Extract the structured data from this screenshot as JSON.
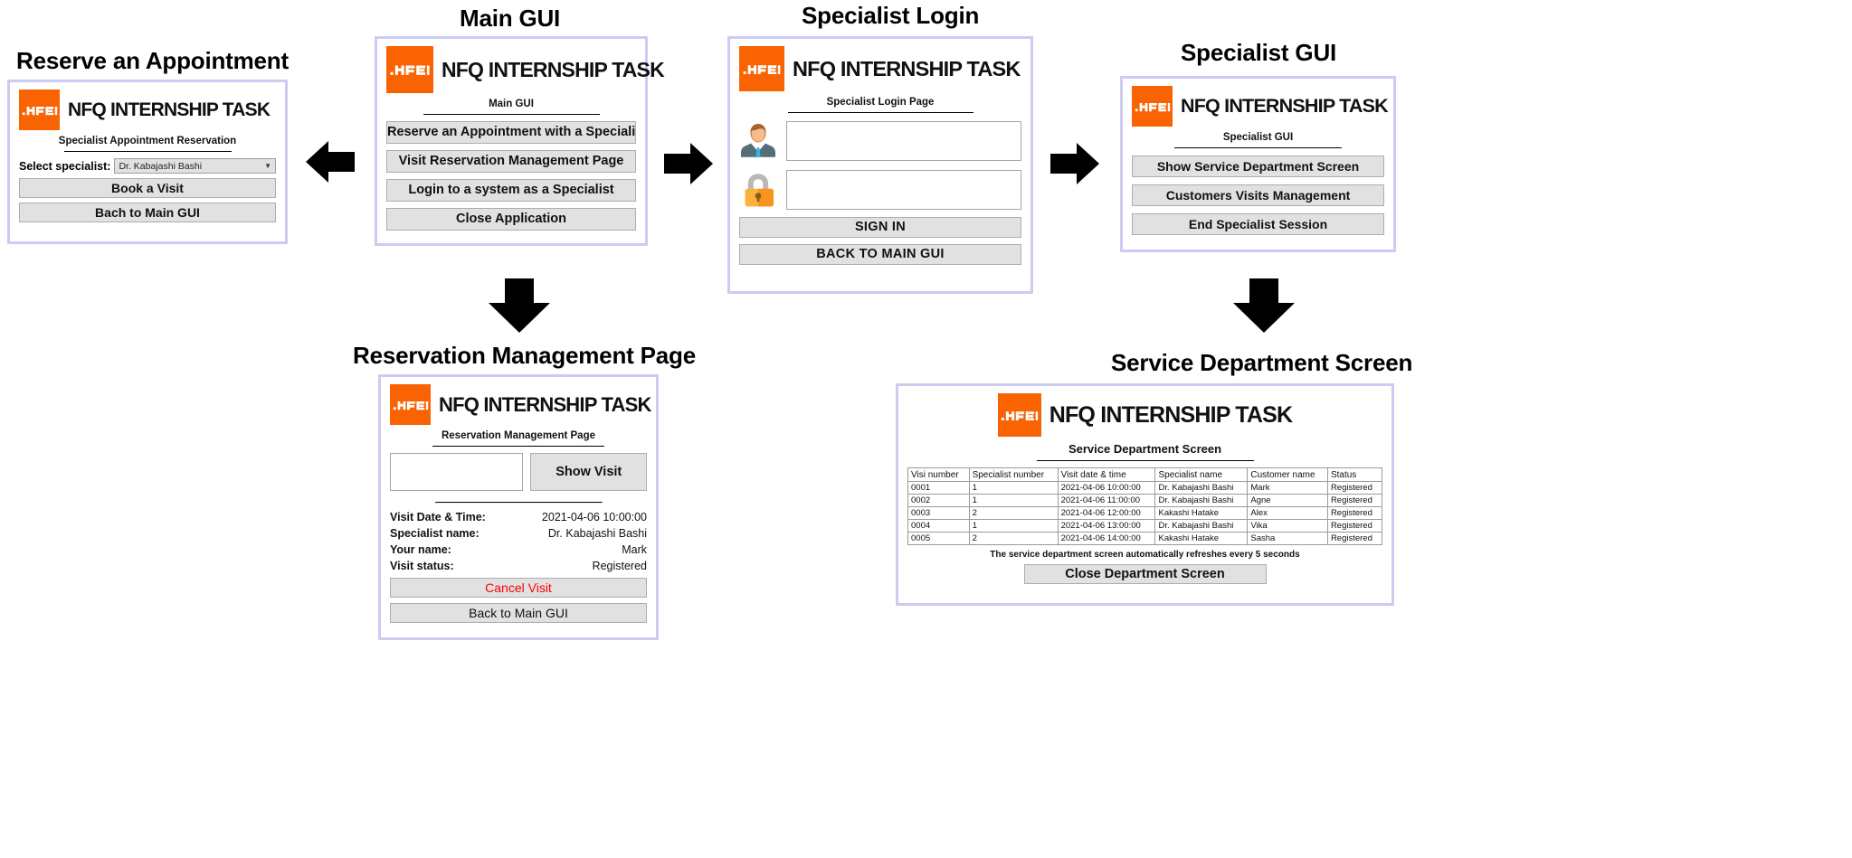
{
  "brand": {
    "title": "NFQ INTERNSHIP TASK",
    "logo_text": ".NFQ",
    "logo_color": "#f96302"
  },
  "captions": {
    "reserve": "Reserve an Appointment",
    "main": "Main GUI",
    "login": "Specialist Login",
    "specialist_gui": "Specialist GUI",
    "reservation_management": "Reservation Management Page",
    "service_department": "Service Department Screen"
  },
  "reserve_window": {
    "subtitle": "Specialist Appointment Reservation",
    "select_label": "Select specialist:",
    "select_value": "Dr. Kabajashi Bashi",
    "select_caret": "chevron-down-icon",
    "buttons": [
      "Book a Visit",
      "Bach to Main GUI"
    ]
  },
  "main_window": {
    "subtitle": "Main GUI",
    "buttons": [
      "Reserve an Appointment with a Specialist",
      "Visit Reservation Management Page",
      "Login to a system as a Specialist",
      "Close Application"
    ]
  },
  "login_window": {
    "subtitle": "Specialist Login Page",
    "username_icon": "user-avatar-icon",
    "username_value": "",
    "password_icon": "padlock-icon",
    "password_value": "",
    "buttons": [
      "SIGN IN",
      "BACK TO MAIN GUI"
    ]
  },
  "specialist_gui_window": {
    "subtitle": "Specialist GUI",
    "buttons": [
      "Show Service Department Screen",
      "Customers Visits Management",
      "End Specialist Session"
    ]
  },
  "reservation_management_window": {
    "subtitle": "Reservation Management Page",
    "search_value": "",
    "show_visit_button": "Show Visit",
    "details": [
      {
        "label": "Visit Date & Time:",
        "value": "2021-04-06 10:00:00"
      },
      {
        "label": "Specialist name:",
        "value": "Dr. Kabajashi Bashi"
      },
      {
        "label": "Your name:",
        "value": "Mark"
      },
      {
        "label": "Visit status:",
        "value": "Registered"
      }
    ],
    "cancel_button": "Cancel Visit",
    "cancel_color": "#ff0000",
    "back_button": "Back to Main GUI"
  },
  "service_department_window": {
    "subtitle": "Service Department Screen",
    "columns": [
      "Visi number",
      "Specialist number",
      "Visit date & time",
      "Specialist name",
      "Customer name",
      "Status"
    ],
    "rows": [
      [
        "0001",
        "1",
        "2021-04-06 10:00:00",
        "Dr. Kabajashi Bashi",
        "Mark",
        "Registered"
      ],
      [
        "0002",
        "1",
        "2021-04-06 11:00:00",
        "Dr. Kabajashi Bashi",
        "Agne",
        "Registered"
      ],
      [
        "0003",
        "2",
        "2021-04-06 12:00:00",
        "Kakashi Hatake",
        "Alex",
        "Registered"
      ],
      [
        "0004",
        "1",
        "2021-04-06 13:00:00",
        "Dr. Kabajashi Bashi",
        "Vika",
        "Registered"
      ],
      [
        "0005",
        "2",
        "2021-04-06 14:00:00",
        "Kakashi Hatake",
        "Sasha",
        "Registered"
      ]
    ],
    "refresh_note": "The service department screen automatically refreshes every 5 seconds",
    "close_button": "Close Department Screen"
  },
  "arrows": {
    "left": "arrow-left-icon",
    "right_1": "arrow-right-icon",
    "right_2": "arrow-right-icon",
    "down_1": "arrow-down-icon",
    "down_2": "arrow-down-icon"
  }
}
